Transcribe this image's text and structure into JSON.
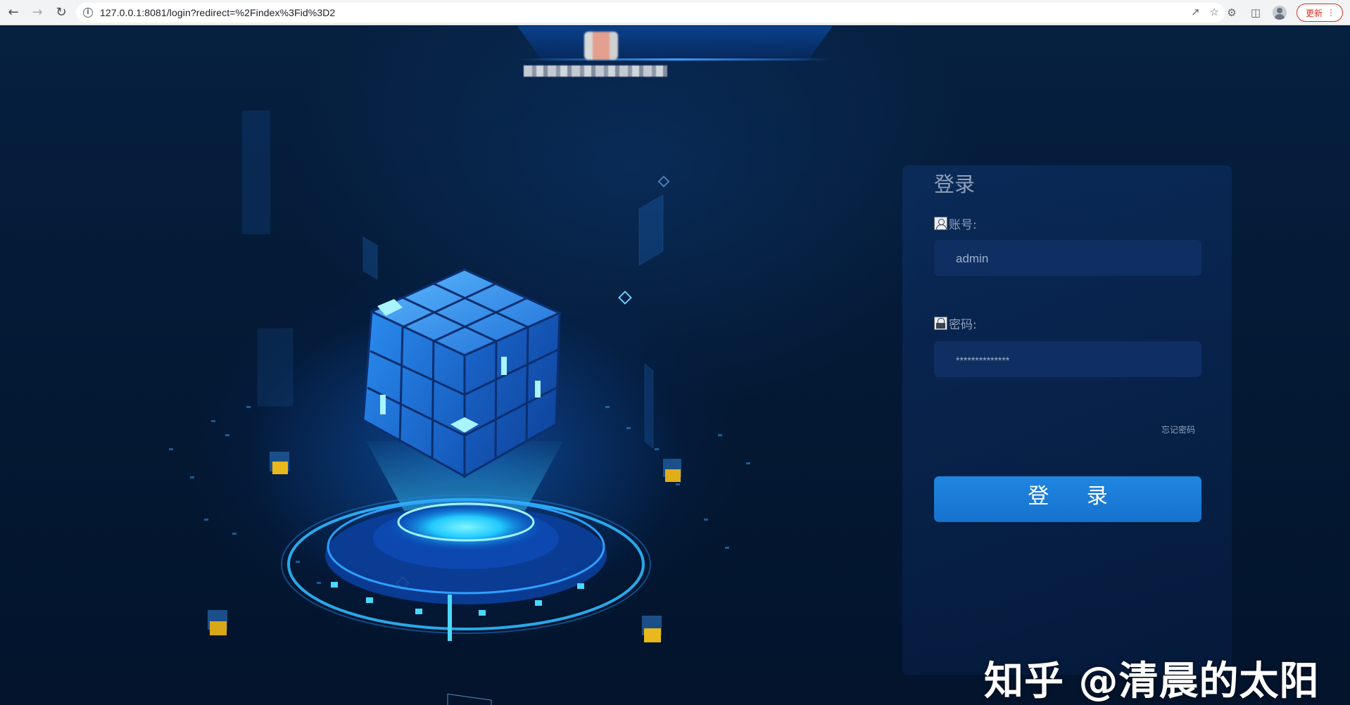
{
  "browser": {
    "back_icon": "arrow-left-icon",
    "forward_icon": "arrow-right-icon",
    "reload_icon": "reload-icon",
    "url": "127.0.0.1:8081/login?redirect=%2Findex%3Fid%3D2",
    "update_label": "更新"
  },
  "login": {
    "title": "登录",
    "account_label": "账号:",
    "account_value": "admin",
    "password_label": "密码:",
    "password_value": "**************",
    "forgot_label": "忘记密码",
    "submit_label": "登 录"
  },
  "watermark": "知乎 @清晨的太阳",
  "colors": {
    "accent": "#1f86e0",
    "panel": "#0f2f63",
    "background": "#041a36"
  }
}
